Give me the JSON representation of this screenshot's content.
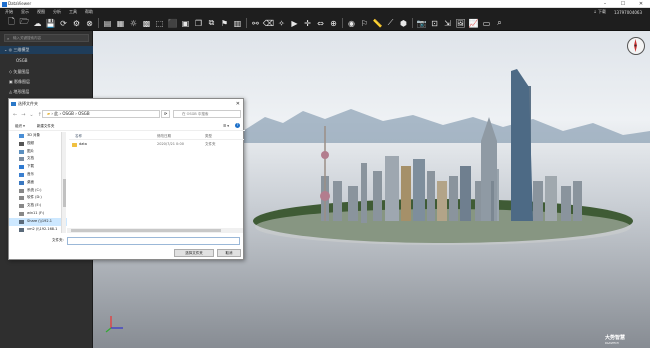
{
  "titlebar": {
    "title": "DataViewer"
  },
  "menubar": {
    "items": [
      "开始",
      "显示",
      "视图",
      "分析",
      "工具",
      "帮助"
    ],
    "download": "↓ 下载",
    "user": "13797004063"
  },
  "sidebar": {
    "search_placeholder": "输入关键搜索内容",
    "tree": [
      {
        "label": "三维模型"
      },
      {
        "label": "OSGB"
      },
      {
        "label": "矢量图层"
      },
      {
        "label": "影像图层"
      },
      {
        "label": "地形图层"
      }
    ]
  },
  "dialog": {
    "title": "选择文件夹",
    "path": [
      "此",
      "OSGB",
      "OSGB"
    ],
    "search_placeholder": "在 OSGB 中搜索",
    "organize": "组织 ▾",
    "new_folder": "新建文件夹",
    "nav_items": [
      "3D 对象",
      "视频",
      "图片",
      "文档",
      "下载",
      "音乐",
      "桌面",
      "系统 (C:)",
      "软件 (D:)",
      "文档 (E:)",
      "win11 (F:)",
      "Share (\\\\192.1",
      "vm2 (\\\\192.168.1"
    ],
    "columns": [
      "名称",
      "修改日期",
      "类型"
    ],
    "files": [
      {
        "name": "data",
        "date": "2020/7/21 0:00",
        "type": "文件夹"
      }
    ],
    "filename_label": "文件夹:",
    "select_button": "选择文件夹",
    "cancel_button": "取消"
  },
  "viewport": {
    "logo_text": "大势智慧",
    "logo_sub": "DAASTECH"
  },
  "colors": {
    "accent": "#2a78c8",
    "dark_bg": "#1e1e1e",
    "selected": "#cde8ff"
  }
}
